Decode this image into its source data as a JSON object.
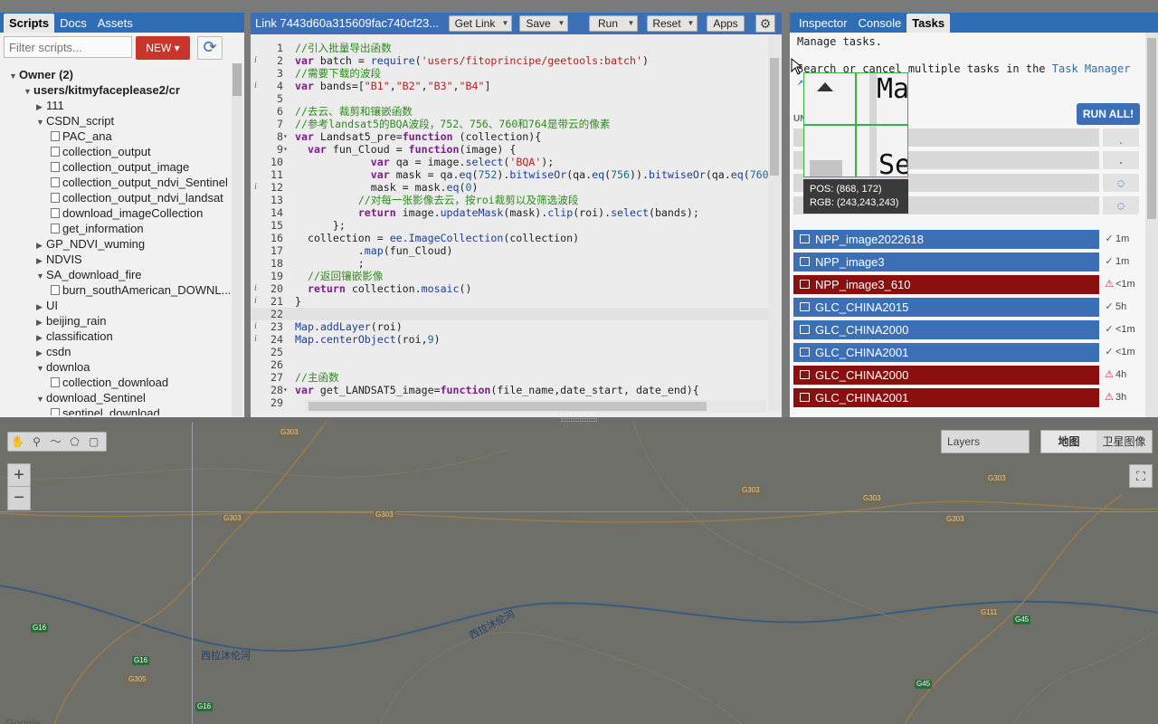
{
  "left_tabs": [
    "Scripts",
    "Docs",
    "Assets"
  ],
  "filter_placeholder": "Filter scripts...",
  "new_button": "NEW",
  "tree": [
    {
      "label": "Owner (2)",
      "level": 0,
      "caret": "down",
      "bold": true
    },
    {
      "label": "users/kitmyfaceplease2/cr",
      "level": 1,
      "caret": "down",
      "bold": true
    },
    {
      "label": "111",
      "level": 2,
      "caret": "right"
    },
    {
      "label": "CSDN_script",
      "level": 2,
      "caret": "down"
    },
    {
      "label": "PAC_ana",
      "level": 3,
      "file": true
    },
    {
      "label": "collection_output",
      "level": 3,
      "file": true
    },
    {
      "label": "collection_output_image",
      "level": 3,
      "file": true
    },
    {
      "label": "collection_output_ndvi_Sentinel",
      "level": 3,
      "file": true
    },
    {
      "label": "collection_output_ndvi_landsat",
      "level": 3,
      "file": true
    },
    {
      "label": "download_imageCollection",
      "level": 3,
      "file": true
    },
    {
      "label": "get_information",
      "level": 3,
      "file": true
    },
    {
      "label": "GP_NDVI_wuming",
      "level": 2,
      "caret": "right"
    },
    {
      "label": "NDVIS",
      "level": 2,
      "caret": "right"
    },
    {
      "label": "SA_download_fire",
      "level": 2,
      "caret": "down"
    },
    {
      "label": "burn_southAmerican_DOWNL...",
      "level": 3,
      "file": true
    },
    {
      "label": "UI",
      "level": 2,
      "caret": "right"
    },
    {
      "label": "beijing_rain",
      "level": 2,
      "caret": "right"
    },
    {
      "label": "classification",
      "level": 2,
      "caret": "right"
    },
    {
      "label": "csdn",
      "level": 2,
      "caret": "right"
    },
    {
      "label": "downloa",
      "level": 2,
      "caret": "down"
    },
    {
      "label": "collection_download",
      "level": 3,
      "file": true
    },
    {
      "label": "download_Sentinel",
      "level": 2,
      "caret": "down"
    },
    {
      "label": "sentinel_download",
      "level": 3,
      "file": true
    }
  ],
  "code_toolbar": {
    "title": "Link 7443d60a315609fac740cf23...",
    "get_link": "Get Link",
    "save": "Save",
    "run": "Run",
    "reset": "Reset",
    "apps": "Apps"
  },
  "code_lines": [
    {
      "n": "1",
      "info": "",
      "fold": "",
      "parts": [
        [
          "c-cmt",
          "//引入批量导出函数"
        ]
      ]
    },
    {
      "n": "2",
      "info": "i",
      "fold": "",
      "parts": [
        [
          "c-kw",
          "var"
        ],
        [
          "",
          " batch = "
        ],
        [
          "c-fn",
          "require"
        ],
        [
          "",
          "("
        ],
        [
          "c-str",
          "'users/fitoprincipe/geetools:batch'"
        ],
        [
          "",
          ")"
        ]
      ]
    },
    {
      "n": "3",
      "info": "",
      "fold": "",
      "parts": [
        [
          "c-cmt",
          "//需要下载的波段"
        ]
      ]
    },
    {
      "n": "4",
      "info": "i",
      "fold": "",
      "parts": [
        [
          "c-kw",
          "var"
        ],
        [
          "",
          " bands=["
        ],
        [
          "c-str",
          "\"B1\""
        ],
        [
          "",
          ","
        ],
        [
          "c-str",
          "\"B2\""
        ],
        [
          "",
          ","
        ],
        [
          "c-str",
          "\"B3\""
        ],
        [
          "",
          ","
        ],
        [
          "c-str",
          "\"B4\""
        ],
        [
          "",
          "]"
        ]
      ]
    },
    {
      "n": "5",
      "info": "",
      "fold": "",
      "parts": [
        [
          "",
          ""
        ]
      ]
    },
    {
      "n": "6",
      "info": "",
      "fold": "",
      "parts": [
        [
          "c-cmt",
          "//去云、裁剪和镶嵌函数"
        ]
      ]
    },
    {
      "n": "7",
      "info": "",
      "fold": "",
      "parts": [
        [
          "c-cmt",
          "//参考landsat5的BQA波段，752、756、760和764是带云的像素"
        ]
      ]
    },
    {
      "n": "8",
      "info": "",
      "fold": "▾",
      "parts": [
        [
          "c-kw",
          "var"
        ],
        [
          "",
          " Landsat5_pre="
        ],
        [
          "c-kw",
          "function"
        ],
        [
          "",
          " (collection){"
        ]
      ]
    },
    {
      "n": "9",
      "info": "",
      "fold": "▾",
      "parts": [
        [
          "",
          "  "
        ],
        [
          "c-kw",
          "var"
        ],
        [
          "",
          " fun_Cloud = "
        ],
        [
          "c-kw",
          "function"
        ],
        [
          "",
          "(image) {"
        ]
      ]
    },
    {
      "n": "10",
      "info": "",
      "fold": "",
      "parts": [
        [
          "",
          "            "
        ],
        [
          "c-kw",
          "var"
        ],
        [
          "",
          " qa = image."
        ],
        [
          "c-fn",
          "select"
        ],
        [
          "",
          "("
        ],
        [
          "c-str",
          "'BQA'"
        ],
        [
          "",
          ");"
        ]
      ]
    },
    {
      "n": "11",
      "info": "",
      "fold": "",
      "parts": [
        [
          "",
          "            "
        ],
        [
          "c-kw",
          "var"
        ],
        [
          "",
          " mask = qa."
        ],
        [
          "c-fn",
          "eq"
        ],
        [
          "",
          "("
        ],
        [
          "c-num",
          "752"
        ],
        [
          "",
          ")."
        ],
        [
          "c-fn",
          "bitwiseOr"
        ],
        [
          "",
          "(qa."
        ],
        [
          "c-fn",
          "eq"
        ],
        [
          "",
          "("
        ],
        [
          "c-num",
          "756"
        ],
        [
          "",
          "))."
        ],
        [
          "c-fn",
          "bitwiseOr"
        ],
        [
          "",
          "(qa."
        ],
        [
          "c-fn",
          "eq"
        ],
        [
          "",
          "("
        ],
        [
          "c-num",
          "760"
        ]
      ]
    },
    {
      "n": "12",
      "info": "i",
      "fold": "",
      "parts": [
        [
          "",
          "            mask = mask."
        ],
        [
          "c-fn",
          "eq"
        ],
        [
          "",
          "("
        ],
        [
          "c-num",
          "0"
        ],
        [
          "",
          ")"
        ]
      ]
    },
    {
      "n": "13",
      "info": "",
      "fold": "",
      "parts": [
        [
          "",
          "          "
        ],
        [
          "c-cmt",
          "//对每一张影像去云，按roi裁剪以及筛选波段"
        ]
      ]
    },
    {
      "n": "14",
      "info": "",
      "fold": "",
      "parts": [
        [
          "",
          "          "
        ],
        [
          "c-kw",
          "return"
        ],
        [
          "",
          " image."
        ],
        [
          "c-fn",
          "updateMask"
        ],
        [
          "",
          "(mask)."
        ],
        [
          "c-fn",
          "clip"
        ],
        [
          "",
          "(roi)."
        ],
        [
          "c-fn",
          "select"
        ],
        [
          "",
          "(bands);"
        ]
      ]
    },
    {
      "n": "15",
      "info": "",
      "fold": "",
      "parts": [
        [
          "",
          "      };"
        ]
      ]
    },
    {
      "n": "16",
      "info": "",
      "fold": "",
      "parts": [
        [
          "",
          "  collection = "
        ],
        [
          "c-def",
          "ee.ImageCollection"
        ],
        [
          "",
          "(collection)"
        ]
      ]
    },
    {
      "n": "17",
      "info": "",
      "fold": "",
      "parts": [
        [
          "",
          "          ."
        ],
        [
          "c-fn",
          "map"
        ],
        [
          "",
          "(fun_Cloud)"
        ]
      ]
    },
    {
      "n": "18",
      "info": "",
      "fold": "",
      "parts": [
        [
          "",
          "          ;"
        ]
      ]
    },
    {
      "n": "19",
      "info": "",
      "fold": "",
      "parts": [
        [
          "",
          "  "
        ],
        [
          "c-cmt",
          "//返回镶嵌影像"
        ]
      ]
    },
    {
      "n": "20",
      "info": "i",
      "fold": "",
      "parts": [
        [
          "",
          "  "
        ],
        [
          "c-kw",
          "return"
        ],
        [
          "",
          " collection."
        ],
        [
          "c-fn",
          "mosaic"
        ],
        [
          "",
          "()"
        ]
      ]
    },
    {
      "n": "21",
      "info": "i",
      "fold": "",
      "parts": [
        [
          "",
          "}"
        ]
      ]
    },
    {
      "n": "22",
      "info": "",
      "fold": "",
      "parts": [
        [
          "",
          ""
        ]
      ]
    },
    {
      "n": "23",
      "info": "i",
      "fold": "",
      "parts": [
        [
          "c-fn",
          "Map"
        ],
        [
          "",
          "."
        ],
        [
          "c-fn",
          "addLayer"
        ],
        [
          "",
          "(roi)"
        ]
      ]
    },
    {
      "n": "24",
      "info": "i",
      "fold": "",
      "parts": [
        [
          "c-fn",
          "Map"
        ],
        [
          "",
          "."
        ],
        [
          "c-fn",
          "centerObject"
        ],
        [
          "",
          "(roi,"
        ],
        [
          "c-num",
          "9"
        ],
        [
          "",
          ")"
        ]
      ]
    },
    {
      "n": "25",
      "info": "",
      "fold": "",
      "parts": [
        [
          "",
          ""
        ]
      ]
    },
    {
      "n": "26",
      "info": "",
      "fold": "",
      "parts": [
        [
          "",
          ""
        ]
      ]
    },
    {
      "n": "27",
      "info": "",
      "fold": "",
      "parts": [
        [
          "c-cmt",
          "//主函数"
        ]
      ]
    },
    {
      "n": "28",
      "info": "",
      "fold": "▾",
      "parts": [
        [
          "c-kw",
          "var"
        ],
        [
          "",
          " get_LANDSAT5_image="
        ],
        [
          "c-kw",
          "function"
        ],
        [
          "",
          "(file_name,date_start, date_end){"
        ]
      ]
    },
    {
      "n": "29",
      "info": "",
      "fold": "",
      "parts": [
        [
          "",
          ""
        ]
      ]
    }
  ],
  "right_tabs": [
    "Inspector",
    "Console",
    "Tasks"
  ],
  "tasks": {
    "line1": "Manage tasks.",
    "line2_prefix": "Search or cancel multiple tasks in the ",
    "task_manager_link": "Task Manager",
    "run_all": "RUN ALL!",
    "unsubmitted_label": "UN",
    "items": [
      {
        "name": "NPP_image2022618",
        "state": "ok",
        "time": "1m"
      },
      {
        "name": "NPP_image3",
        "state": "ok",
        "time": "1m"
      },
      {
        "name": "NPP_image3_610",
        "state": "err",
        "time": "<1m"
      },
      {
        "name": "GLC_CHINA2015",
        "state": "ok",
        "time": "5h"
      },
      {
        "name": "GLC_CHINA2000",
        "state": "ok",
        "time": "<1m"
      },
      {
        "name": "GLC_CHINA2001",
        "state": "ok",
        "time": "<1m"
      },
      {
        "name": "GLC_CHINA2000",
        "state": "err",
        "time": "4h"
      },
      {
        "name": "GLC_CHINA2001",
        "state": "err",
        "time": "3h"
      }
    ]
  },
  "magnifier": {
    "pos_label": "POS:",
    "pos_value": "(868, 172)",
    "rgb_label": "RGB:",
    "rgb_value": "(243,243,243)"
  },
  "map": {
    "layers": "Layers",
    "map_type_map": "地图",
    "map_type_satellite": "卫星图像",
    "river_1": "西拉沐伦河",
    "river_2": "西拉沐伦河",
    "road_labels": [
      "G303",
      "G303",
      "G303",
      "G303",
      "G303",
      "G303",
      "G303",
      "G16",
      "G16",
      "G16",
      "G305",
      "G45",
      "G45",
      "G111"
    ],
    "google": "Google"
  },
  "colors": {
    "accent_blue": "#3b6fb6",
    "error_red": "#8b0f0f",
    "new_red": "#c9342b",
    "magnifier_green": "#3cb043"
  }
}
